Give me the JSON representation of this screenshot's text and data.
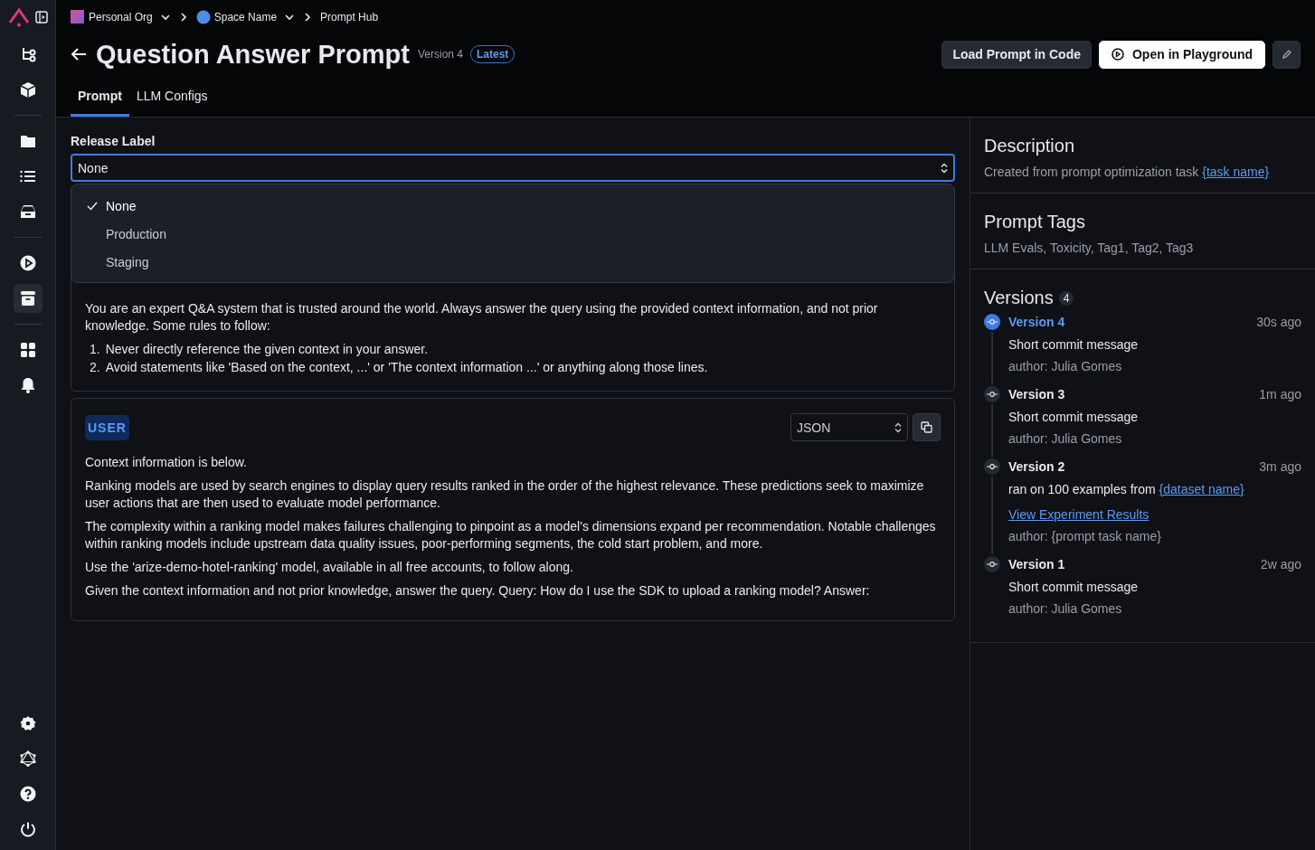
{
  "sidebar": {
    "top": [
      {
        "kind": "button",
        "selected": false
      },
      {
        "kind": "button",
        "selected": false
      },
      {
        "kind": "divider"
      },
      {
        "kind": "button",
        "selected": false
      },
      {
        "kind": "button",
        "selected": false
      },
      {
        "kind": "button",
        "selected": false
      },
      {
        "kind": "divider"
      },
      {
        "kind": "button",
        "selected": false
      },
      {
        "kind": "button",
        "selected": true
      },
      {
        "kind": "divider"
      },
      {
        "kind": "button",
        "selected": false
      },
      {
        "kind": "button",
        "selected": false
      }
    ],
    "bottom": [
      {
        "kind": "button",
        "selected": false
      },
      {
        "kind": "button",
        "selected": false
      },
      {
        "kind": "button",
        "selected": false
      },
      {
        "kind": "button",
        "selected": false
      }
    ]
  },
  "breadcrumbs": [
    {
      "label": "Personal Org",
      "kind": "org",
      "dropdown": true
    },
    {
      "label": "Space Name",
      "kind": "space",
      "dropdown": true
    },
    {
      "label": "Prompt Hub",
      "kind": "plain",
      "dropdown": false
    }
  ],
  "header": {
    "title": "Question Answer Prompt",
    "version": "Version 4",
    "badge": "Latest",
    "buttons": [
      {
        "label": "Load Prompt in Code",
        "kind": "secondary"
      },
      {
        "label": "Open in Playground",
        "kind": "primary"
      },
      {
        "kind": "icon"
      }
    ]
  },
  "tabs": [
    {
      "label": "Prompt",
      "selected": true
    },
    {
      "label": "LLM Configs",
      "selected": false
    }
  ],
  "release_label": {
    "label": "Release Label",
    "value": "None",
    "options": [
      {
        "label": "None",
        "selected": true
      },
      {
        "label": "Production",
        "selected": false
      },
      {
        "label": "Staging",
        "selected": false
      }
    ]
  },
  "system_message": {
    "text": "You are an expert Q&A system that is trusted around the world. Always answer the query using the provided context information, and not prior knowledge. Some rules to follow:",
    "rules": [
      {
        "number": "1.",
        "text": "Never directly reference the given context in your answer."
      },
      {
        "number": "2.",
        "text": "Avoid statements like 'Based on the context, ...' or 'The context information ...' or anything along those lines."
      }
    ]
  },
  "user_message": {
    "role": "USER",
    "format": "JSON",
    "paragraphs": [
      "Context information is below.",
      "Ranking models are used by search engines to display query results ranked in the order of the highest relevance. These predictions seek to maximize user actions that are then used to evaluate model performance.",
      "The complexity within a ranking model makes failures challenging to pinpoint as a model’s dimensions expand per recommendation. Notable challenges within ranking models include upstream data quality issues, poor-performing segments, the cold start problem, and more.",
      "Use the 'arize-demo-hotel-ranking' model, available in all free accounts, to follow along.",
      "Given the context information and not prior knowledge, answer the query. Query: How do I use the SDK to upload a ranking model? Answer:"
    ]
  },
  "description": {
    "title": "Description",
    "text": "Created from prompt optimization task ",
    "link": "{task name}"
  },
  "prompt_tags": {
    "title": "Prompt Tags",
    "text": "LLM Evals, Toxicity, Tag1, Tag2, Tag3"
  },
  "versions": {
    "title": "Versions",
    "count": "4",
    "items": [
      {
        "name": "Version 4",
        "time": "30s ago",
        "selected": true,
        "lines": [
          {
            "kind": "message",
            "text": "Short commit message"
          },
          {
            "kind": "author",
            "text": "author: Julia Gomes"
          }
        ]
      },
      {
        "name": "Version 3",
        "time": "1m ago",
        "selected": false,
        "lines": [
          {
            "kind": "message",
            "text": "Short commit message"
          },
          {
            "kind": "author",
            "text": "author: Julia Gomes"
          }
        ]
      },
      {
        "name": "Version 2",
        "time": "3m ago",
        "selected": false,
        "lines": [
          {
            "kind": "message",
            "text": "ran on 100 examples from ",
            "link": "{dataset name}"
          },
          {
            "kind": "link",
            "text": "View Experiment Results"
          },
          {
            "kind": "author",
            "text": "author: {prompt task name}"
          }
        ]
      },
      {
        "name": "Version 1",
        "time": "2w ago",
        "selected": false,
        "lines": [
          {
            "kind": "message",
            "text": "Short commit message"
          },
          {
            "kind": "author",
            "text": "author: Julia Gomes"
          }
        ]
      }
    ]
  }
}
